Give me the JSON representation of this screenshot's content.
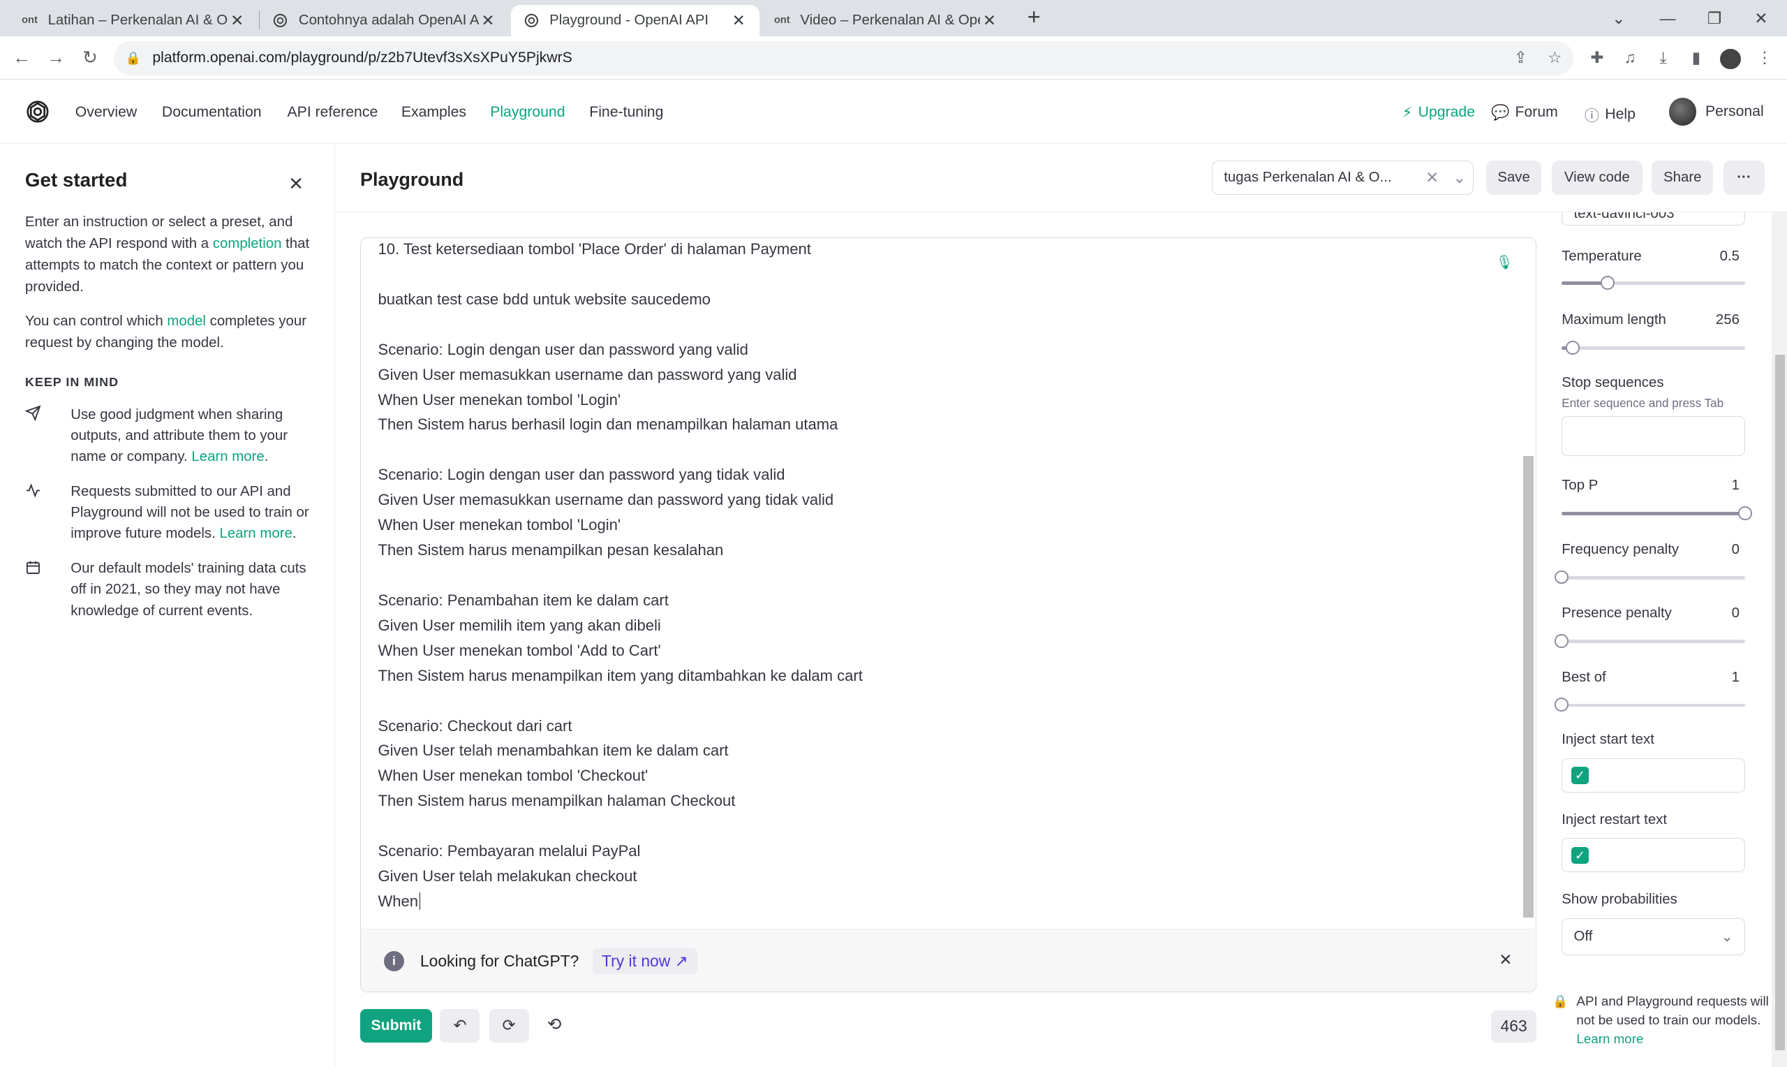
{
  "browser": {
    "tabs": [
      {
        "title": "Latihan – Perkenalan AI & OpenAI",
        "favicon": "ont"
      },
      {
        "title": "Contohnya adalah OpenAI API",
        "favicon": "openai"
      },
      {
        "title": "Playground - OpenAI API",
        "favicon": "openai",
        "active": true
      },
      {
        "title": "Video – Perkenalan AI & OpenAI",
        "favicon": "ont"
      }
    ],
    "url": "platform.openai.com/playground/p/z2b7Utevf3sXsXPuY5PjkwrS"
  },
  "nav": {
    "links": [
      "Overview",
      "Documentation",
      "API reference",
      "Examples",
      "Playground",
      "Fine-tuning"
    ],
    "active": "Playground",
    "upgrade": "Upgrade",
    "forum": "Forum",
    "help": "Help",
    "account": "Personal"
  },
  "left_panel": {
    "title": "Get started",
    "p1_before": "Enter an instruction or select a preset, and watch the API respond with a ",
    "p1_link": "completion",
    "p1_after": " that attempts to match the context or pattern you provided.",
    "p2_before": "You can control which ",
    "p2_link": "model",
    "p2_after": " completes your request by changing the model.",
    "keep_in_mind": "KEEP IN MIND",
    "tips": [
      {
        "icon": "send-icon",
        "text": "Use good judgment when sharing outputs, and attribute them to your name or company. ",
        "link": "Learn more",
        "after": "."
      },
      {
        "icon": "activity-icon",
        "text": "Requests submitted to our API and Playground will not be used to train or improve future models. ",
        "link": "Learn more",
        "after": "."
      },
      {
        "icon": "calendar-icon",
        "text": "Our default models' training data cuts off in 2021, so they may not have knowledge of current events.",
        "link": "",
        "after": ""
      }
    ]
  },
  "header": {
    "title": "Playground",
    "preset": "tugas Perkenalan AI & O...",
    "save": "Save",
    "view_code": "View code",
    "share": "Share",
    "more": "···"
  },
  "editor": {
    "lines": [
      "10. Test ketersediaan tombol 'Place Order' di halaman Payment",
      "",
      "buatkan test case bdd untuk website saucedemo",
      "",
      "Scenario: Login dengan user dan password yang valid",
      "Given User memasukkan username dan password yang valid",
      "When User menekan tombol 'Login'",
      "Then Sistem harus berhasil login dan menampilkan halaman utama",
      "",
      "Scenario: Login dengan user dan password yang tidak valid",
      "Given User memasukkan username dan password yang tidak valid",
      "When User menekan tombol 'Login'",
      "Then Sistem harus menampilkan pesan kesalahan",
      "",
      "Scenario: Penambahan item ke dalam cart",
      "Given User memilih item yang akan dibeli",
      "When User menekan tombol 'Add to Cart'",
      "Then Sistem harus menampilkan item yang ditambahkan ke dalam cart",
      "",
      "Scenario: Checkout dari cart",
      "Given User telah menambahkan item ke dalam cart",
      "When User menekan tombol 'Checkout'",
      "Then Sistem harus menampilkan halaman Checkout",
      "",
      "Scenario: Pembayaran melalui PayPal",
      "Given User telah melakukan checkout",
      "When"
    ],
    "banner_text": "Looking for ChatGPT?",
    "banner_link": "Try it now"
  },
  "footer": {
    "submit": "Submit",
    "token_count": "463"
  },
  "settings": {
    "model": "text-davinci-003",
    "temperature": {
      "label": "Temperature",
      "value": "0.5",
      "fraction": 0.25
    },
    "max_length": {
      "label": "Maximum length",
      "value": "256",
      "fraction": 0.06
    },
    "stop_sequences": {
      "label": "Stop sequences",
      "hint": "Enter sequence and press Tab"
    },
    "top_p": {
      "label": "Top P",
      "value": "1",
      "fraction": 1.0
    },
    "frequency_penalty": {
      "label": "Frequency penalty",
      "value": "0",
      "fraction": 0
    },
    "presence_penalty": {
      "label": "Presence penalty",
      "value": "0",
      "fraction": 0
    },
    "best_of": {
      "label": "Best of",
      "value": "1",
      "fraction": 0
    },
    "inject_start": {
      "label": "Inject start text",
      "checked": true
    },
    "inject_restart": {
      "label": "Inject restart text",
      "checked": true
    },
    "show_probabilities": {
      "label": "Show probabilities",
      "value": "Off"
    },
    "note": "API and Playground requests will not be used to train our models. ",
    "note_link": "Learn more"
  },
  "colors": {
    "accent": "#10a37f",
    "link_purple": "#5436da"
  }
}
